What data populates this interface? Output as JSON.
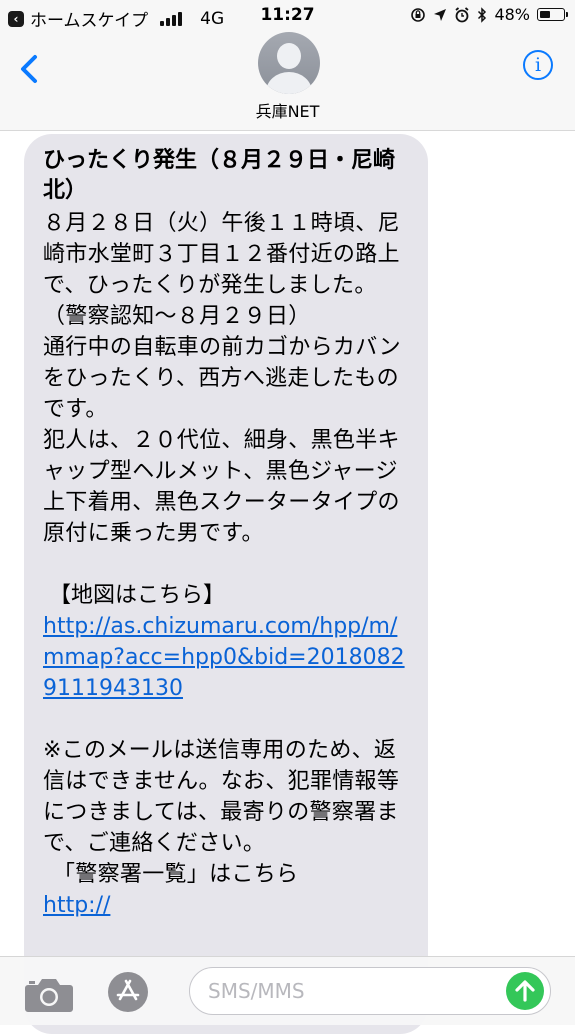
{
  "status_bar": {
    "back_app": "ホームスケイプ",
    "network": "4G",
    "time": "11:27",
    "battery": "48%",
    "battery_level": 0.48
  },
  "header": {
    "contact_name": "兵庫NET",
    "info_label": "i"
  },
  "message": {
    "title": "ひったくり発生（８月２９日・尼崎北）",
    "body": "８月２８日（火）午後１１時頃、尼崎市水堂町３丁目１２番付近の路上で、ひったくりが発生しました。（警察認知〜８月２９日）\n通行中の自転車の前カゴからカバンをひったくり、西方へ逃走したものです。\n犯人は、２０代位、細身、黒色半キャップ型ヘルメット、黒色ジャージ上下着用、黒色スクータータイプの原付に乗った男です。",
    "map_label": "【地図はこちら】",
    "map_link": "http://as.chizumaru.com/hpp/m/mmap?acc=hpp0&bid=20180829111943130",
    "note": "※このメールは送信専用のため、返信はできません。なお、犯罪情報等につきましては、最寄りの警察署まで、ご連絡ください。",
    "station_list_label": "「警察署一覧」はこちら",
    "station_link": "http://"
  },
  "input_bar": {
    "placeholder": "SMS/MMS"
  },
  "colors": {
    "ios_blue": "#0a7aff",
    "bubble_gray": "#e6e5eb",
    "send_green": "#34c759",
    "link_blue": "#0a63d6"
  }
}
